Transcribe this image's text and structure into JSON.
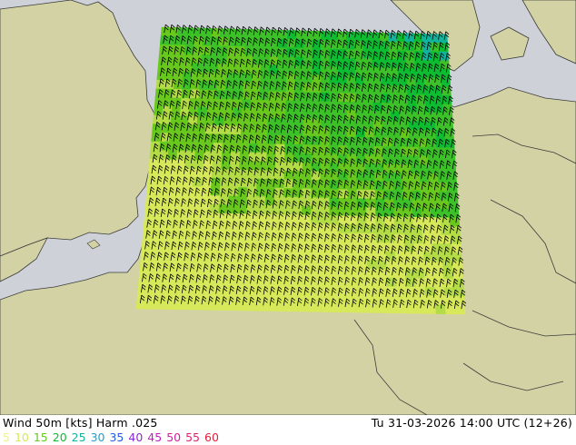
{
  "footer": {
    "title": "Wind 50m [kts] Harm .025",
    "valid_time": "Tu 31-03-2026 14:00 UTC (12+26)"
  },
  "legend": [
    {
      "label": "5",
      "color": "#f0f08c"
    },
    {
      "label": "10",
      "color": "#d7e85a"
    },
    {
      "label": "15",
      "color": "#68c81e"
    },
    {
      "label": "20",
      "color": "#0ebc32"
    },
    {
      "label": "25",
      "color": "#11b49a"
    },
    {
      "label": "30",
      "color": "#1da1d2"
    },
    {
      "label": "35",
      "color": "#245adc"
    },
    {
      "label": "40",
      "color": "#8c28d2"
    },
    {
      "label": "45",
      "color": "#c01ec0"
    },
    {
      "label": "50",
      "color": "#d21ea0"
    },
    {
      "label": "55",
      "color": "#e61e6e"
    },
    {
      "label": "60",
      "color": "#e61e3c"
    }
  ],
  "colors": {
    "sea": "#ced2d8",
    "land": "#d2d2a4",
    "border": "#3c3c3c"
  }
}
